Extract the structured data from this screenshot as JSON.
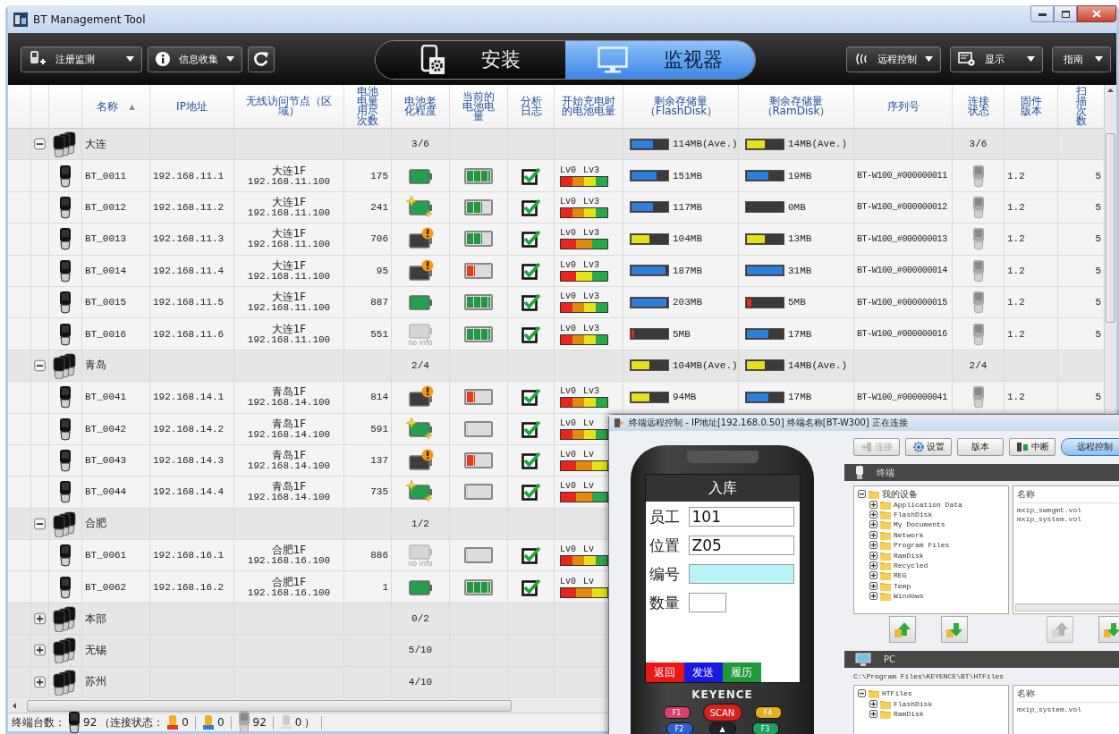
{
  "window": {
    "title": "BT Management Tool"
  },
  "toolbar": {
    "left": [
      {
        "kind": "register",
        "label": "注册监测"
      },
      {
        "kind": "info",
        "label": "信息收集"
      }
    ],
    "mode_tabs": [
      {
        "kind": "install",
        "label": "安装",
        "selected": false
      },
      {
        "kind": "monitor",
        "label": "监视器",
        "selected": true
      }
    ],
    "right": [
      {
        "kind": "remote",
        "label": "远程控制"
      },
      {
        "kind": "display",
        "label": "显示"
      },
      {
        "kind": "guide",
        "label": "指南"
      }
    ]
  },
  "table": {
    "columns": [
      {
        "label": "名称",
        "sort_mark": "▲"
      },
      {
        "label": "IP地址"
      },
      {
        "label": "无线访问节点（区域）"
      },
      {
        "label": "电池电量用尽次数"
      },
      {
        "label": "电池老化程度"
      },
      {
        "label": "当前的电池电量"
      },
      {
        "label": "分析日志"
      },
      {
        "label": "开始充电时的电池电量"
      },
      {
        "label": "剩余存储量（FlashDisk）"
      },
      {
        "label": "剩余存储量（RamDisk）"
      },
      {
        "label": "序列号"
      },
      {
        "label": "连接状态"
      },
      {
        "label": "固件版本"
      },
      {
        "label": "扫描次数"
      }
    ],
    "rows": [
      {
        "kind": "group",
        "name": "大连",
        "expanded": true,
        "count": "3/6",
        "flash": {
          "text": "114MB(Ave.)",
          "level": 0.6,
          "color": "#2f7fd8"
        },
        "ram": {
          "text": "14MB(Ave.)",
          "level": 0.5,
          "color": "#e8e01a"
        },
        "connection": "3/6"
      },
      {
        "kind": "device",
        "name": "BT_0011",
        "ip": "192.168.11.1",
        "ap": "大连1F",
        "ap_ip": "192.168.11.100",
        "uses": "175",
        "aging": {
          "kind": "good"
        },
        "battery": {
          "level": 1
        },
        "log_checked": true,
        "meter": {
          "low": "Lv0",
          "high": "Lv3",
          "segments": [
            {
              "color": "#e8261c"
            },
            {
              "color": "#e08a0e"
            },
            {
              "color": "#e6e215"
            },
            {
              "color": "#2aa84a"
            }
          ]
        },
        "flash": {
          "text": "151MB",
          "level": 0.7,
          "color": "#2f7fd8"
        },
        "ram": {
          "text": "19MB",
          "level": 0.6,
          "color": "#2f7fd8"
        },
        "serial": "BT-W100_#000000011",
        "firmware": "1.2",
        "scans": "5"
      },
      {
        "kind": "device",
        "name": "BT_0012",
        "ip": "192.168.11.2",
        "ap": "大连1F",
        "ap_ip": "192.168.11.100",
        "uses": "241",
        "aging": {
          "kind": "new"
        },
        "battery": {
          "level": 0.67
        },
        "log_checked": true,
        "meter": {
          "low": "Lv0",
          "high": "Lv3",
          "segments": [
            {
              "color": "#e8261c"
            },
            {
              "color": "#e08a0e"
            },
            {
              "color": "#e6e215"
            },
            {
              "color": "#2aa84a"
            }
          ]
        },
        "flash": {
          "text": "117MB",
          "level": 0.6,
          "color": "#2f7fd8"
        },
        "ram": {
          "text": "0MB",
          "level": 0
        },
        "serial": "BT-W100_#000000012",
        "firmware": "1.2",
        "scans": "5"
      },
      {
        "kind": "device",
        "name": "BT_0013",
        "ip": "192.168.11.3",
        "ap": "大连1F",
        "ap_ip": "192.168.11.100",
        "uses": "706",
        "aging": {
          "kind": "warn"
        },
        "battery": {
          "level": 0.67
        },
        "log_checked": true,
        "meter": {
          "low": "Lv0",
          "high": "Lv3",
          "segments": [
            {
              "color": "#e8261c"
            },
            {
              "color": "#e08a0e"
            },
            {
              "color": "#2aa84a"
            }
          ]
        },
        "flash": {
          "text": "104MB",
          "level": 0.5,
          "color": "#e8e01a"
        },
        "ram": {
          "text": "13MB",
          "level": 0.5,
          "color": "#e8e01a"
        },
        "serial": "BT-W100_#000000013",
        "firmware": "1.2",
        "scans": "5"
      },
      {
        "kind": "device",
        "name": "BT_0014",
        "ip": "192.168.11.4",
        "ap": "大连1F",
        "ap_ip": "192.168.11.100",
        "uses": "95",
        "aging": {
          "kind": "warn"
        },
        "battery": {
          "level": 0.33
        },
        "log_checked": true,
        "meter": {
          "low": "Lv0",
          "high": "Lv3",
          "segments": [
            {
              "color": "#e8261c"
            },
            {
              "color": "#e6e215"
            },
            {
              "color": "#2aa84a"
            }
          ]
        },
        "flash": {
          "text": "187MB",
          "level": 0.95,
          "color": "#2f7fd8"
        },
        "ram": {
          "text": "31MB",
          "level": 1,
          "color": "#2f7fd8"
        },
        "serial": "BT-W100_#000000014",
        "firmware": "1.2",
        "scans": "5"
      },
      {
        "kind": "device",
        "name": "BT_0015",
        "ip": "192.168.11.5",
        "ap": "大连1F",
        "ap_ip": "192.168.11.100",
        "uses": "887",
        "aging": {
          "kind": "good"
        },
        "battery": {
          "level": 1
        },
        "log_checked": true,
        "meter": {
          "low": "Lv0",
          "high": "Lv3",
          "segments": [
            {
              "color": "#e8261c"
            },
            {
              "color": "#e08a0e"
            },
            {
              "color": "#e6e215"
            },
            {
              "color": "#2aa84a"
            }
          ]
        },
        "flash": {
          "text": "203MB",
          "level": 0.98,
          "color": "#2f7fd8"
        },
        "ram": {
          "text": "5MB",
          "level": 0.12,
          "color": "#e8261c"
        },
        "serial": "BT-W100_#000000015",
        "firmware": "1.2",
        "scans": "5"
      },
      {
        "kind": "device",
        "name": "BT_0016",
        "ip": "192.168.11.6",
        "ap": "大连1F",
        "ap_ip": "192.168.11.100",
        "uses": "551",
        "aging": {
          "kind": "noinfo",
          "caption": "no info"
        },
        "battery": {
          "level": 1
        },
        "log_checked": true,
        "meter": {
          "low": "Lv0",
          "high": "Lv3",
          "segments": [
            {
              "color": "#e8261c"
            },
            {
              "color": "#e08a0e"
            },
            {
              "color": "#e6e215"
            },
            {
              "color": "#2aa84a"
            }
          ]
        },
        "flash": {
          "text": "5MB",
          "level": 0.08,
          "color": "#e8261c"
        },
        "ram": {
          "text": "17MB",
          "level": 0.6,
          "color": "#2f7fd8"
        },
        "serial": "BT-W100_#000000016",
        "firmware": "1.2",
        "scans": "5"
      },
      {
        "kind": "group",
        "name": "青岛",
        "expanded": true,
        "count": "2/4",
        "flash": {
          "text": "104MB(Ave.)",
          "level": 0.5,
          "color": "#e8e01a"
        },
        "ram": {
          "text": "14MB(Ave.)",
          "level": 0.5,
          "color": "#e8e01a"
        },
        "connection": "2/4"
      },
      {
        "kind": "device",
        "name": "BT_0041",
        "ip": "192.168.14.1",
        "ap": "青岛1F",
        "ap_ip": "192.168.14.100",
        "uses": "814",
        "aging": {
          "kind": "warn"
        },
        "battery": {
          "level": 0.33
        },
        "log_checked": true,
        "meter": {
          "low": "Lv0",
          "high": "Lv3",
          "segments": [
            {
              "color": "#e8261c"
            },
            {
              "color": "#e08a0e"
            },
            {
              "color": "#e6e215"
            },
            {
              "color": "#2aa84a"
            }
          ]
        },
        "flash": {
          "text": "94MB",
          "level": 0.5,
          "color": "#e8e01a"
        },
        "ram": {
          "text": "17MB",
          "level": 0.6,
          "color": "#2f7fd8"
        },
        "serial": "BT-W100_#000000041",
        "firmware": "1.2",
        "scans": "5"
      },
      {
        "kind": "device",
        "name": "BT_0042",
        "ip": "192.168.14.2",
        "ap": "青岛1F",
        "ap_ip": "192.168.14.100",
        "uses": "591",
        "aging": {
          "kind": "new"
        },
        "battery": {
          "level": 0
        },
        "log_checked": true,
        "meter": {
          "low": "Lv0",
          "high": "Lv",
          "segments": [
            {
              "color": "#e8261c"
            },
            {
              "color": "#e08a0e"
            },
            {
              "color": "#e6e215"
            },
            {
              "color": "#2aa84a"
            }
          ]
        }
      },
      {
        "kind": "device",
        "name": "BT_0043",
        "ip": "192.168.14.3",
        "ap": "青岛1F",
        "ap_ip": "192.168.14.100",
        "uses": "137",
        "aging": {
          "kind": "warn"
        },
        "battery": {
          "level": 0.33
        },
        "log_checked": true,
        "meter": {
          "low": "Lv0",
          "high": "Lv",
          "segments": [
            {
              "color": "#e8261c"
            },
            {
              "color": "#e08a0e"
            },
            {
              "color": "#e6e215"
            }
          ]
        }
      },
      {
        "kind": "device",
        "name": "BT_0044",
        "ip": "192.168.14.4",
        "ap": "青岛1F",
        "ap_ip": "192.168.14.100",
        "uses": "735",
        "aging": {
          "kind": "new"
        },
        "battery": {
          "level": 0
        },
        "log_checked": true,
        "meter": {
          "low": "Lv0",
          "high": "Lv",
          "segments": [
            {
              "color": "#e8261c"
            },
            {
              "color": "#e08a0e"
            },
            {
              "color": "#2aa84a"
            }
          ]
        }
      },
      {
        "kind": "group",
        "name": "合肥",
        "expanded": true,
        "count": "1/2"
      },
      {
        "kind": "device",
        "name": "BT_0061",
        "ip": "192.168.16.1",
        "ap": "合肥1F",
        "ap_ip": "192.168.16.100",
        "uses": "886",
        "aging": {
          "kind": "noinfo",
          "caption": "no info"
        },
        "battery": {
          "level": 0
        },
        "log_checked": true,
        "meter": {
          "low": "Lv0",
          "high": "Lv",
          "segments": [
            {
              "color": "#e8261c"
            },
            {
              "color": "#e08a0e"
            },
            {
              "color": "#e6e215"
            },
            {
              "color": "#2aa84a"
            }
          ]
        }
      },
      {
        "kind": "device",
        "name": "BT_0062",
        "ip": "192.168.16.2",
        "ap": "合肥1F",
        "ap_ip": "192.168.16.100",
        "uses": "1",
        "aging": {
          "kind": "good"
        },
        "battery": {
          "level": 1
        },
        "log_checked": true,
        "meter": {
          "low": "Lv0",
          "high": "Lv",
          "segments": [
            {
              "color": "#e8261c"
            },
            {
              "color": "#e08a0e"
            },
            {
              "color": "#e6e215"
            }
          ]
        }
      },
      {
        "kind": "group",
        "name": "本部",
        "expanded": false,
        "count": "0/2"
      },
      {
        "kind": "group",
        "name": "无锡",
        "expanded": false,
        "count": "5/10"
      },
      {
        "kind": "group",
        "name": "苏州",
        "expanded": false,
        "count": "4/10"
      }
    ]
  },
  "status_bar": {
    "label": "终端台数：",
    "total": "92",
    "open": "（连接状态：",
    "items": [
      {
        "kind": "live",
        "count": "0"
      },
      {
        "kind": "recent",
        "count": "0"
      },
      {
        "kind": "connected",
        "count": "92"
      },
      {
        "kind": "noinfo",
        "count": "0"
      }
    ],
    "close": "）"
  },
  "remote_window": {
    "title": "终端远程控制 - IP地址[192.168.0.50] 终端名称[BT-W300] 正在连接",
    "terminal": {
      "screen_title": "入库",
      "fields": [
        {
          "label": "员工",
          "value": "101",
          "kind": "long",
          "focused": false
        },
        {
          "label": "位置",
          "value": "Z05",
          "kind": "long",
          "focused": false
        },
        {
          "label": "编号",
          "kind": "long",
          "focused": true
        },
        {
          "label": "数量",
          "kind": "short",
          "focused": false
        }
      ],
      "softkeys": [
        {
          "label": "返回",
          "color": "#e81818"
        },
        {
          "label": "发送",
          "color": "#1a1ae0"
        },
        {
          "label": "履历",
          "color": "#1f9a3a"
        }
      ],
      "brand": "KEYENCE",
      "keys": [
        {
          "label": "F1",
          "color": "#d8406a"
        },
        {
          "label": "SCAN",
          "color": "#d42020"
        },
        {
          "label": "F4",
          "color": "#e0b020"
        }
      ],
      "keys_row2": [
        {
          "label": "F2",
          "color": "#3060d0"
        },
        {
          "label": "▲",
          "color": "#222222"
        },
        {
          "label": "F3",
          "color": "#20a060"
        }
      ]
    },
    "buttons": [
      {
        "kind": "connect",
        "label": "连接",
        "disabled": true,
        "selected": false
      },
      {
        "kind": "settings",
        "label": "设置",
        "disabled": false,
        "selected": false
      },
      {
        "kind": "plain",
        "label": "版本",
        "disabled": false,
        "selected": false
      },
      {
        "kind": "disconnect",
        "label": "中断",
        "disabled": false,
        "selected": false
      },
      {
        "kind": "plain",
        "label": "远程控制",
        "disabled": false,
        "selected": true
      }
    ],
    "device_panel": {
      "title": "终端",
      "tree": {
        "label": "我的设备",
        "expanded": true,
        "children": [
          {
            "label": "Application Data",
            "expanded": false
          },
          {
            "label": "FlashDisk",
            "expanded": false
          },
          {
            "label": "My Documents",
            "expanded": false
          },
          {
            "label": "Network",
            "expanded": false
          },
          {
            "label": "Program Files",
            "expanded": false
          },
          {
            "label": "RamDisk",
            "expanded": false
          },
          {
            "label": "Recycled",
            "expanded": false
          },
          {
            "label": "REG",
            "expanded": false
          },
          {
            "label": "Temp",
            "expanded": false
          },
          {
            "label": "Windows",
            "expanded": false
          }
        ]
      },
      "files_header": "名称",
      "files": [
        "mxip_swmgmt.vol",
        "mxip_system.vol"
      ]
    },
    "transfer_buttons": [
      {
        "kind": "upload",
        "disabled": false
      },
      {
        "kind": "download",
        "disabled": false
      },
      {
        "kind": "upload",
        "disabled": true
      },
      {
        "kind": "download",
        "disabled": false
      }
    ],
    "pc_panel": {
      "title": "PC",
      "path": "C:\\Program Files\\KEYENCE\\BT\\HTFiles",
      "tree": {
        "label": "HTFiles",
        "expanded": true,
        "children": [
          {
            "label": "FlashDisk",
            "expanded": false
          },
          {
            "label": "RamDisk",
            "expanded": false
          }
        ]
      },
      "files_header": "名称",
      "files": [
        "mxip_system.vol"
      ]
    }
  }
}
